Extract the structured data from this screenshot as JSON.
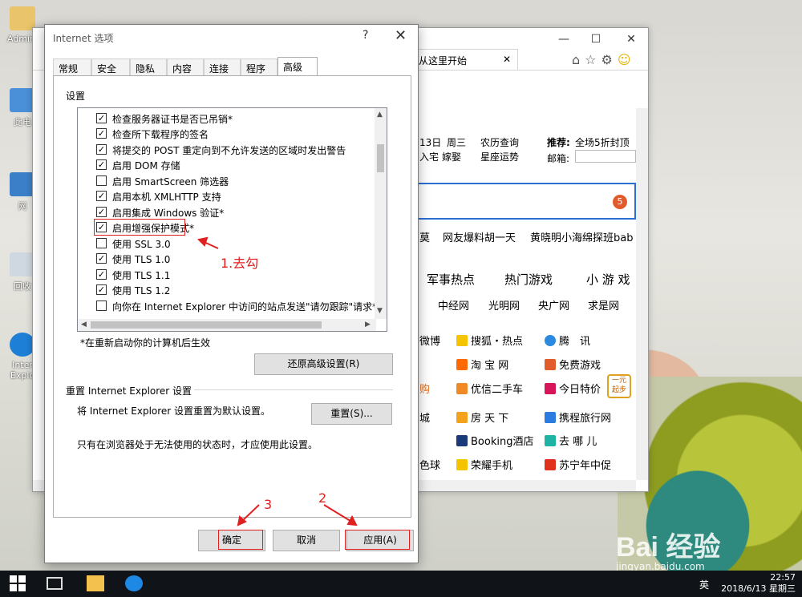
{
  "desktop": {
    "icons": [
      {
        "label": "Admini",
        "name": "user-folder-icon"
      },
      {
        "label": "此电",
        "name": "this-pc-icon"
      },
      {
        "label": "网",
        "name": "network-icon"
      },
      {
        "label": "回收",
        "name": "recycle-bin-icon"
      },
      {
        "label": "Inter Explo",
        "name": "ie-desktop-icon"
      }
    ]
  },
  "ie_window": {
    "tab_title": "从这里开始",
    "header": {
      "date": "13日",
      "weekday": "周三",
      "lunar": "农历查询",
      "ruzhai": "入宅",
      "jiaqu": "嫁娶",
      "xingzuo": "星座运势",
      "tuijian_label": "推荐:",
      "tuijian_value": "全场5折封顶",
      "email_label": "邮箱:"
    },
    "badge": "5",
    "news": [
      "莫",
      "网友爆料胡一天",
      "黄晓明小海绵探班bab"
    ],
    "cats": [
      "军事热点",
      "热门游戏",
      "小 游 戏"
    ],
    "sites": [
      "中经网",
      "光明网",
      "央广网",
      "求是网"
    ],
    "links_col1": [
      "微博",
      "",
      "购",
      "城",
      "",
      "色球"
    ],
    "links_col2": [
      "搜狐・热点",
      "淘 宝 网",
      "优信二手车",
      "房 天 下",
      "Booking酒店",
      "荣耀手机"
    ],
    "links_col3": [
      "腾　讯",
      "免费游戏",
      "今日特价",
      "携程旅行网",
      "去 哪 儿",
      "苏宁年中促"
    ],
    "promo": "一元起步"
  },
  "dialog": {
    "title": "Internet 选项",
    "help": "?",
    "close": "✕",
    "tabs": [
      "常规",
      "安全",
      "隐私",
      "内容",
      "连接",
      "程序",
      "高级"
    ],
    "settings_label": "设置",
    "items": [
      {
        "label": "检查服务器证书是否已吊销*",
        "checked": true
      },
      {
        "label": "检查所下载程序的签名",
        "checked": true
      },
      {
        "label": "将提交的 POST 重定向到不允许发送的区域时发出警告",
        "checked": true
      },
      {
        "label": "启用 DOM 存储",
        "checked": true
      },
      {
        "label": "启用 SmartScreen 筛选器",
        "checked": false
      },
      {
        "label": "启用本机 XMLHTTP 支持",
        "checked": true
      },
      {
        "label": "启用集成 Windows 验证*",
        "checked": true
      },
      {
        "label": "启用增强保护模式*",
        "checked": true
      },
      {
        "label": "使用 SSL 3.0",
        "checked": false
      },
      {
        "label": "使用 TLS 1.0",
        "checked": true
      },
      {
        "label": "使用 TLS 1.1",
        "checked": true
      },
      {
        "label": "使用 TLS 1.2",
        "checked": true
      },
      {
        "label": "向你在 Internet Explorer 中访问的站点发送\"请勿跟踪\"请求*",
        "checked": false
      }
    ],
    "restart_note": "*在重新启动你的计算机后生效",
    "restore_button": "还原高级设置(R)",
    "reset_group": "重置 Internet Explorer 设置",
    "reset_desc": "将 Internet Explorer 设置重置为默认设置。",
    "reset_button": "重置(S)...",
    "reset_note": "只有在浏览器处于无法使用的状态时，才应使用此设置。",
    "ok_button": "确定",
    "cancel_button": "取消",
    "apply_button": "应用(A)"
  },
  "annotations": {
    "step1": "1.去勾",
    "step2": "2",
    "step3": "3",
    "color": "#e02020"
  },
  "taskbar": {
    "time": "22:57",
    "date": "2018/6/13 星期三",
    "lang": "英"
  },
  "watermark": {
    "brand": "Bai 经验",
    "url": "jingyan.baidu.com"
  }
}
